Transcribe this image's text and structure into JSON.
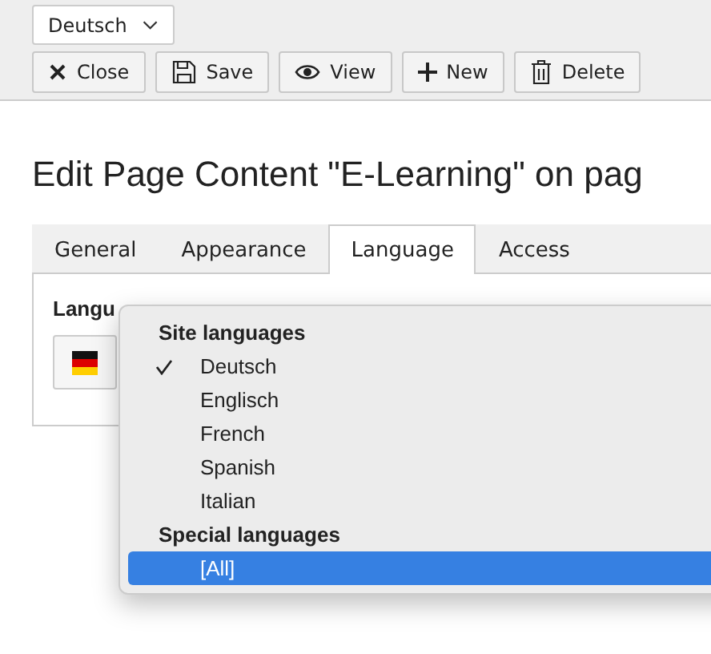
{
  "language_select": {
    "value": "Deutsch"
  },
  "toolbar": [
    {
      "label": "Close",
      "kind": "close"
    },
    {
      "label": "Save",
      "kind": "save"
    },
    {
      "label": "View",
      "kind": "view"
    },
    {
      "label": "New",
      "kind": "new"
    },
    {
      "label": "Delete",
      "kind": "delete"
    }
  ],
  "heading": "Edit Page Content \"E-Learning\" on pag",
  "tabs": [
    {
      "label": "General",
      "selected": false
    },
    {
      "label": "Appearance",
      "selected": false
    },
    {
      "label": "Language",
      "selected": true
    },
    {
      "label": "Access",
      "selected": false
    }
  ],
  "field_label": "Langu",
  "dropdown": [
    {
      "kind": "header",
      "label": "Site languages"
    },
    {
      "kind": "option",
      "label": "Deutsch",
      "checked": true,
      "selected": false
    },
    {
      "kind": "option",
      "label": "Englisch",
      "checked": false,
      "selected": false
    },
    {
      "kind": "option",
      "label": "French",
      "checked": false,
      "selected": false
    },
    {
      "kind": "option",
      "label": "Spanish",
      "checked": false,
      "selected": false
    },
    {
      "kind": "option",
      "label": "Italian",
      "checked": false,
      "selected": false
    },
    {
      "kind": "header",
      "label": "Special languages"
    },
    {
      "kind": "option",
      "label": "[All]",
      "checked": false,
      "selected": true
    }
  ]
}
